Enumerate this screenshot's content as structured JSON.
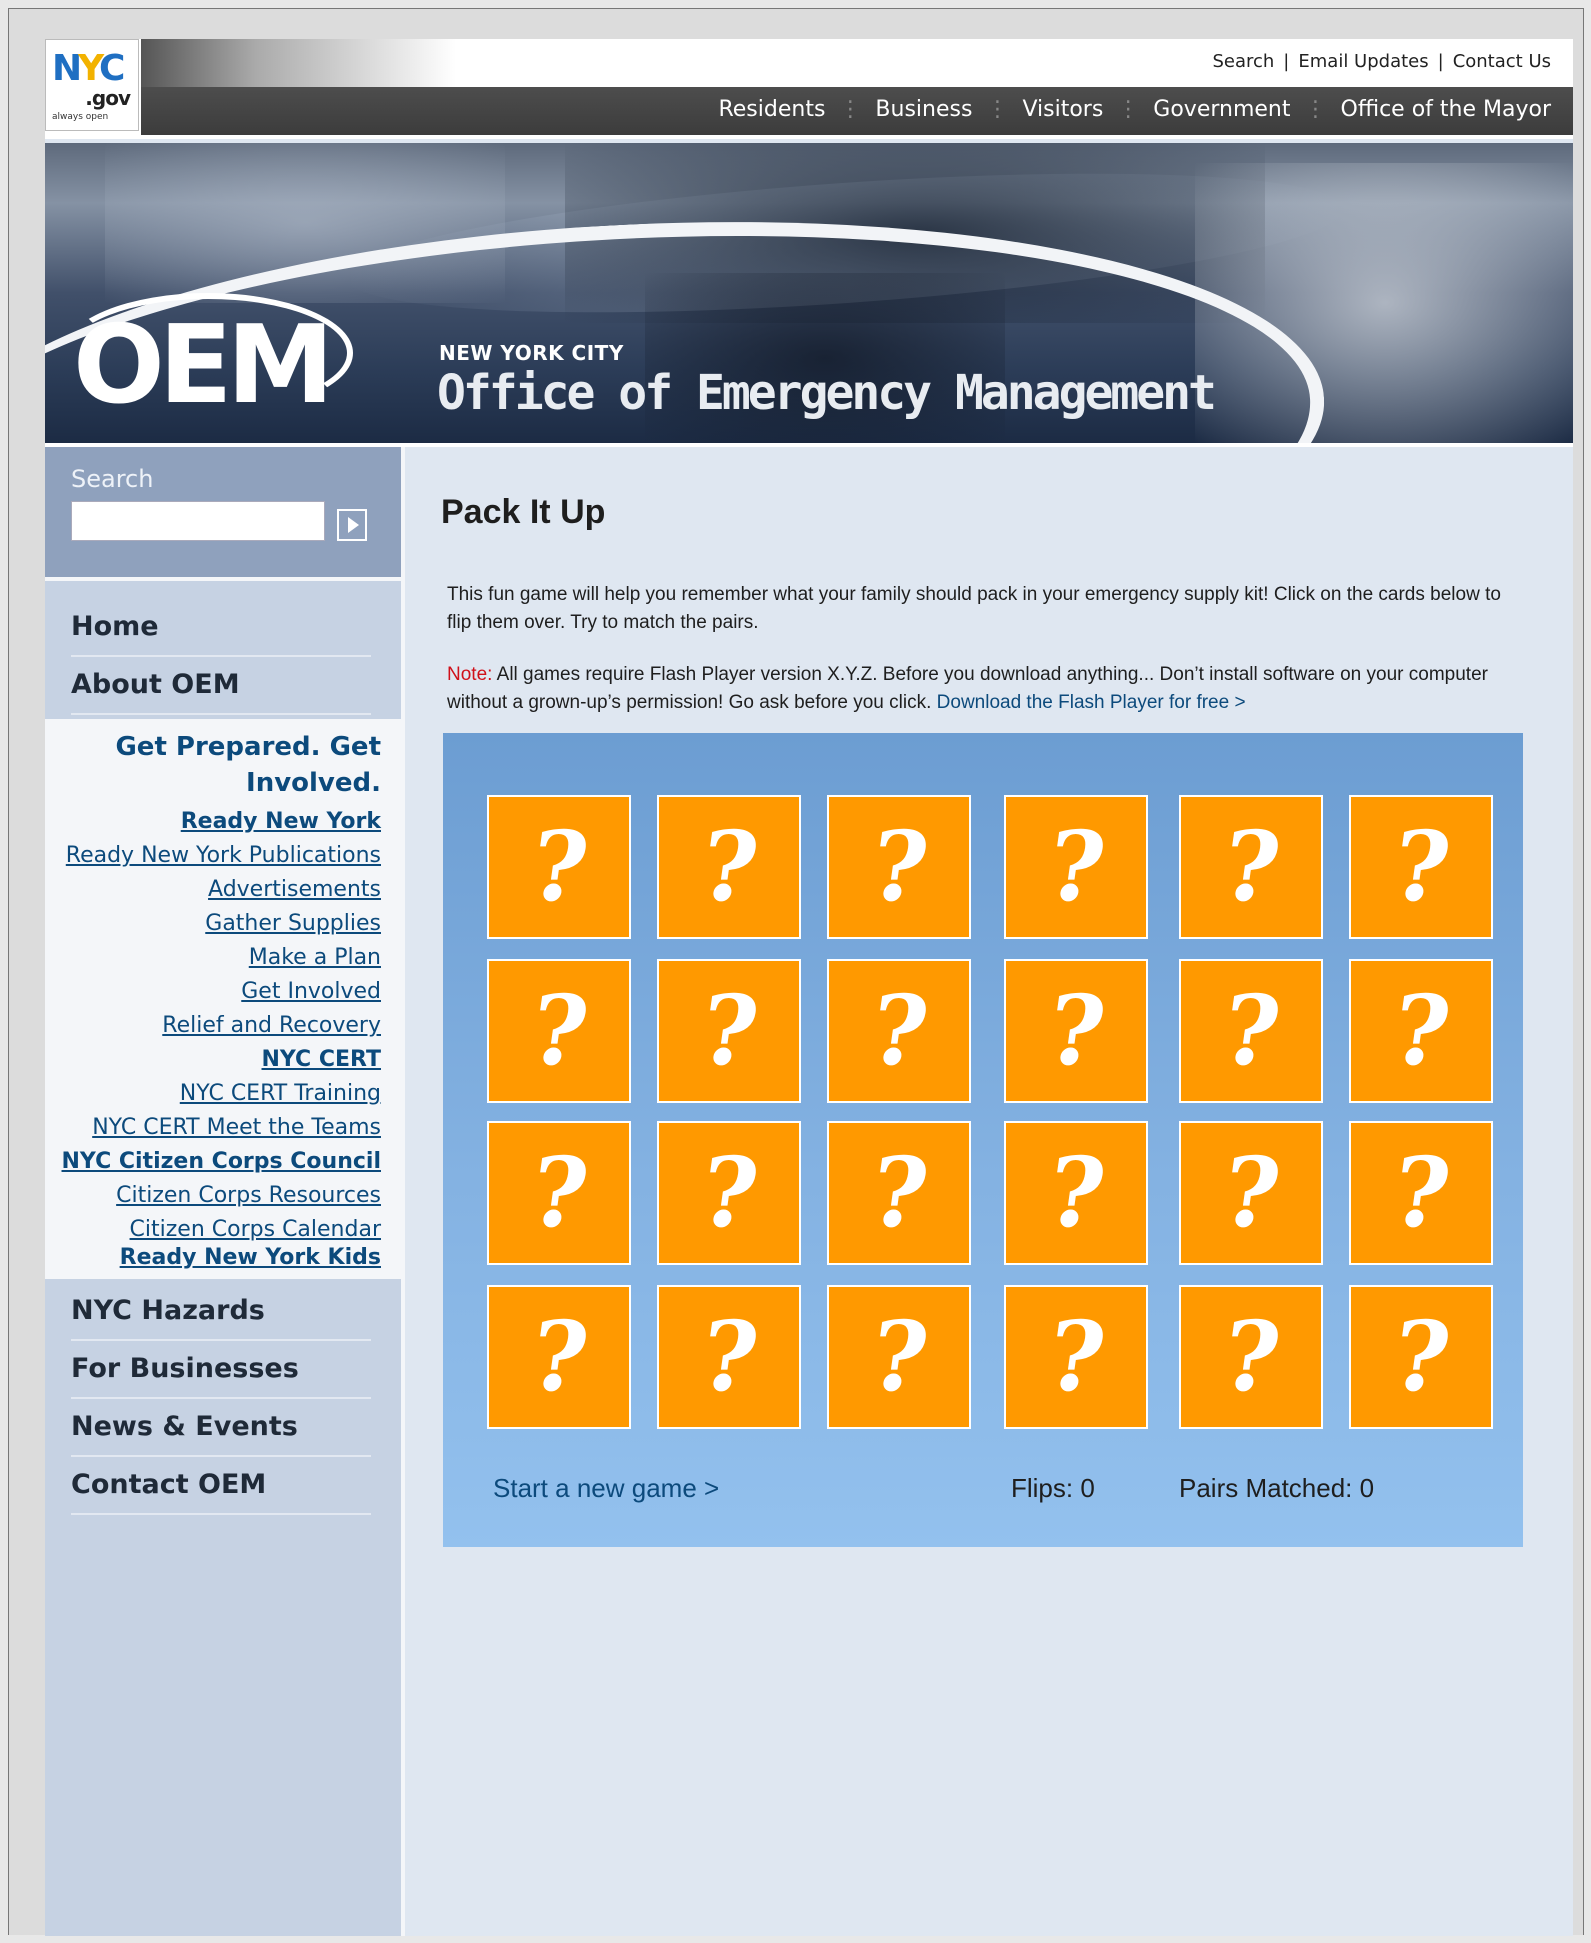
{
  "header": {
    "logo": {
      "main": "NYC",
      "domain": ".gov",
      "tagline": "always open"
    },
    "util_links": [
      "Search",
      "Email Updates",
      "Contact Us"
    ],
    "main_nav": [
      "Residents",
      "Business",
      "Visitors",
      "Government",
      "Office of the Mayor"
    ]
  },
  "banner": {
    "logo_text": "OEM",
    "city_label": "NEW YORK CITY",
    "title": "Office of Emergency Management"
  },
  "sidebar": {
    "search": {
      "label": "Search",
      "placeholder": "",
      "value": "",
      "button_icon": "play-arrow-icon"
    },
    "top_items": [
      "Home",
      "About OEM"
    ],
    "section_heading": "Get Prepared. Get Involved.",
    "sub_items": [
      {
        "label": "Ready New York",
        "bold": true
      },
      {
        "label": "Ready New York Publications",
        "bold": false
      },
      {
        "label": "Advertisements",
        "bold": false
      },
      {
        "label": "Gather Supplies",
        "bold": false
      },
      {
        "label": "Make a Plan",
        "bold": false
      },
      {
        "label": "Get Involved",
        "bold": false
      },
      {
        "label": "Relief and Recovery",
        "bold": false
      },
      {
        "label": "NYC CERT",
        "bold": true
      },
      {
        "label": "NYC CERT Training",
        "bold": false
      },
      {
        "label": "NYC CERT Meet the Teams",
        "bold": false
      },
      {
        "label": "NYC Citizen Corps Council",
        "bold": true
      },
      {
        "label": "Citizen Corps Resources",
        "bold": false
      },
      {
        "label": "Citizen Corps Calendar",
        "bold": false
      },
      {
        "label": "Ready New York Kids",
        "bold": true
      }
    ],
    "bottom_items": [
      "NYC Hazards",
      "For Businesses",
      "News & Events",
      "Contact OEM"
    ]
  },
  "main": {
    "title": "Pack It Up",
    "intro": "This fun game will help you remember what your family should pack in your emergency supply kit! Click on the cards below to flip them over. Try to match the pairs.",
    "note_label": "Note:",
    "note_text": " All games require Flash Player version X.Y.Z. Before you download anything... Don’t install software on your computer without a grown-up’s permission! Go ask before you click. ",
    "note_link": "Download the Flash Player for free >",
    "game": {
      "rows": 4,
      "cols": 6,
      "card_symbol": "?",
      "card_color": "#ff9900",
      "new_game_label": "Start a new game >",
      "flips_label": "Flips:",
      "flips": 0,
      "pairs_label": "Pairs Matched:",
      "pairs": 0
    }
  },
  "colors": {
    "accent_link": "#0c4a7c",
    "note_red": "#d0101a",
    "sidebar_bg": "#c6d2e3",
    "content_bg": "#dfe7f1"
  }
}
